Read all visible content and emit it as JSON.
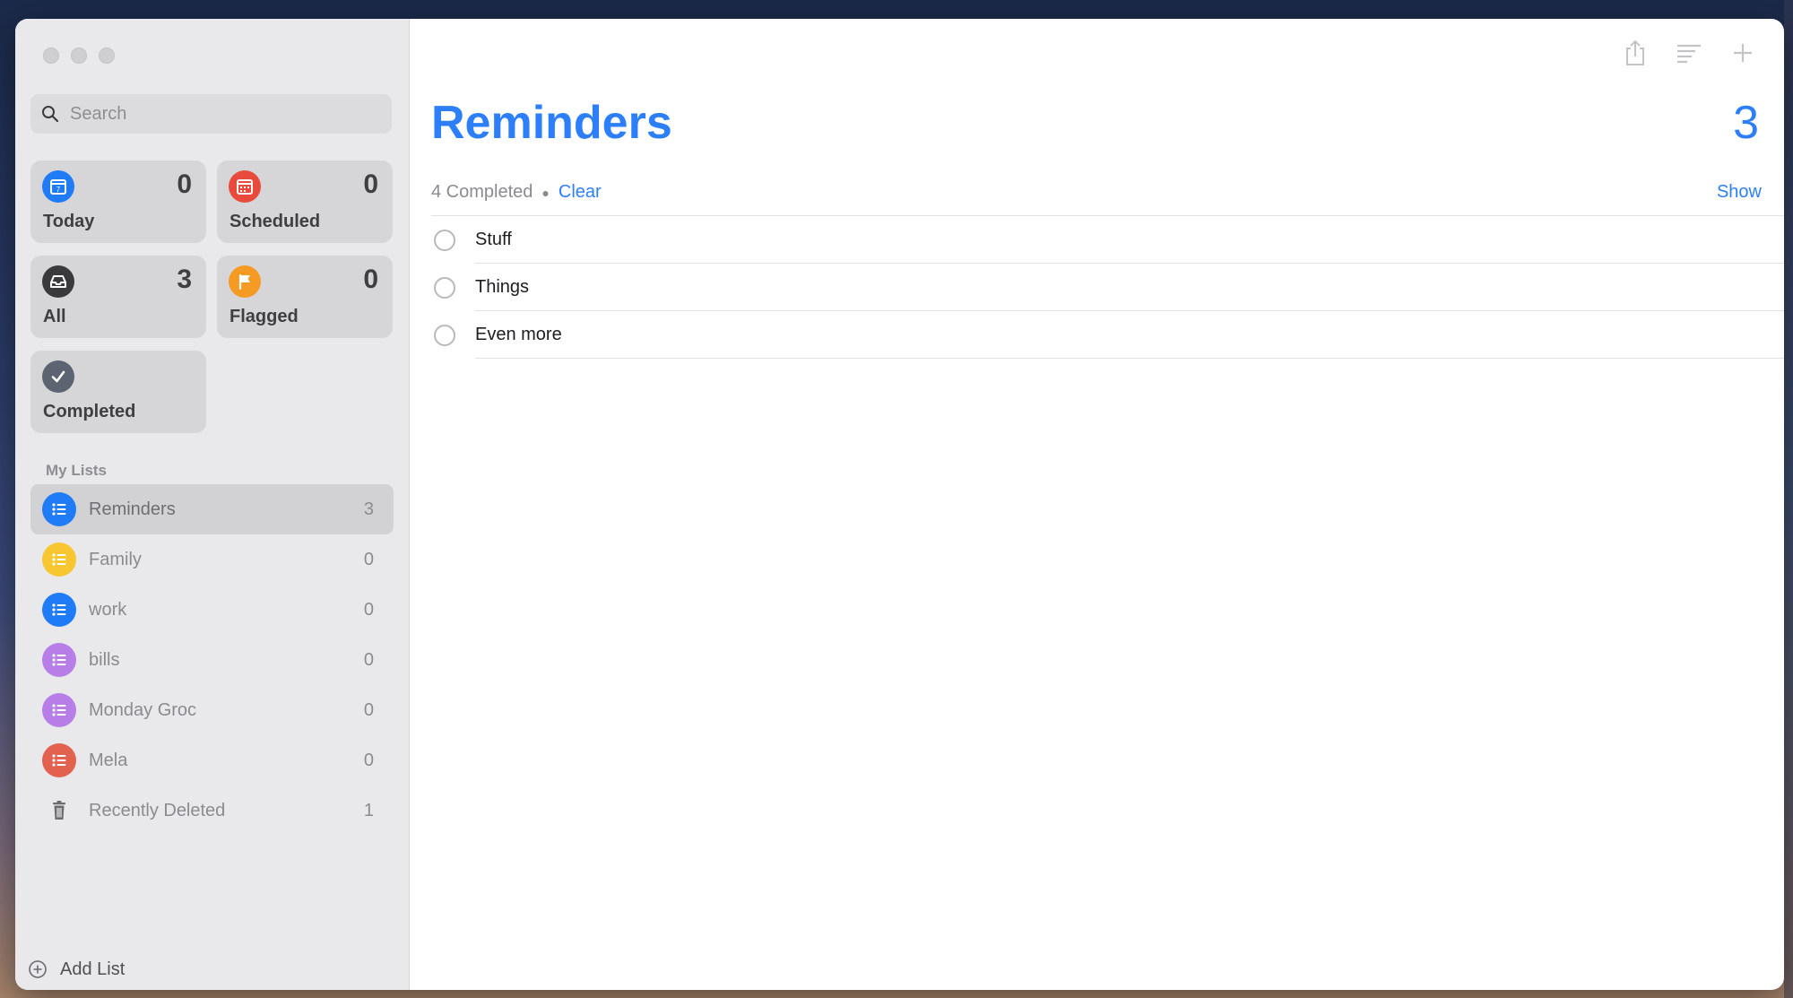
{
  "search": {
    "placeholder": "Search"
  },
  "smart_lists": {
    "today": {
      "label": "Today",
      "count": "0",
      "color": "#1f7cf6",
      "icon": "calendar-today-icon"
    },
    "scheduled": {
      "label": "Scheduled",
      "count": "0",
      "color": "#e84b3c",
      "icon": "calendar-grid-icon"
    },
    "all": {
      "label": "All",
      "count": "3",
      "color": "#3a3a3c",
      "icon": "tray-icon"
    },
    "flagged": {
      "label": "Flagged",
      "count": "0",
      "color": "#f59a23",
      "icon": "flag-icon"
    },
    "completed": {
      "label": "Completed",
      "color": "#5b6470",
      "icon": "checkmark-icon"
    }
  },
  "my_lists": {
    "heading": "My Lists",
    "items": [
      {
        "name": "Reminders",
        "count": "3",
        "color": "#1f7cf6"
      },
      {
        "name": "Family",
        "count": "0",
        "color": "#f8c630"
      },
      {
        "name": "work",
        "count": "0",
        "color": "#1f7cf6"
      },
      {
        "name": "bills",
        "count": "0",
        "color": "#b77ee8"
      },
      {
        "name": "Monday Groc",
        "count": "0",
        "color": "#b77ee8"
      },
      {
        "name": "Mela",
        "count": "0",
        "color": "#e2614f"
      },
      {
        "name": "Recently Deleted",
        "count": "1",
        "icon": "trash-icon"
      }
    ]
  },
  "add_list": {
    "label": "Add List"
  },
  "main": {
    "title": "Reminders",
    "count": "3",
    "completed_text": "4 Completed",
    "clear_label": "Clear",
    "show_label": "Show",
    "tasks": [
      {
        "text": "Stuff"
      },
      {
        "text": "Things"
      },
      {
        "text": "Even more"
      }
    ]
  },
  "colors": {
    "accent": "#2d7ff9"
  }
}
